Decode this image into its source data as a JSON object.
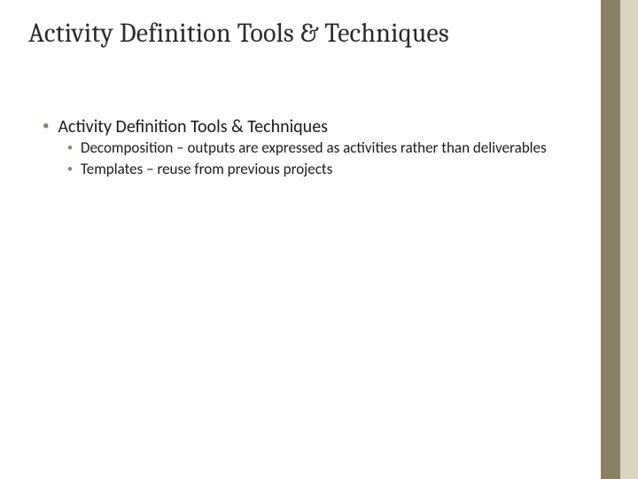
{
  "title": "Activity Definition Tools & Techniques",
  "content": {
    "level1": {
      "text": "Activity Definition Tools & Techniques"
    },
    "level2": {
      "items": [
        {
          "text": "Decomposition – outputs are expressed as activities rather than deliverables"
        },
        {
          "text": "Templates – reuse from previous projects"
        }
      ]
    }
  },
  "accent": {
    "left": "#89815f",
    "right": "#d9d4c0",
    "bullet": "#8a8360"
  }
}
